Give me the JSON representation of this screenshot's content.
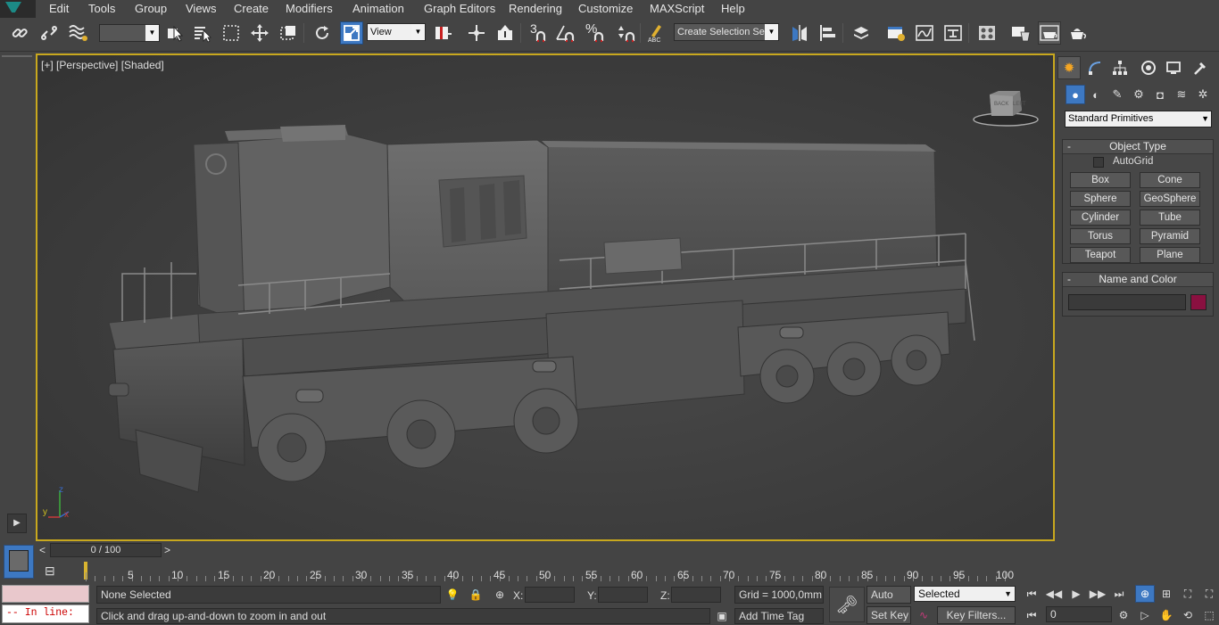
{
  "menubar": {
    "items": [
      "Edit",
      "Tools",
      "Group",
      "Views",
      "Create",
      "Modifiers",
      "Animation",
      "Graph Editors",
      "Rendering",
      "Customize",
      "MAXScript",
      "Help"
    ]
  },
  "toolbar": {
    "selection_filter_value": "",
    "reference_coord_value": "View",
    "named_selection_placeholder": "Create Selection Se",
    "snap_3_label": "3",
    "icons": [
      "link-icon",
      "unlink-icon",
      "bind-space-warp-icon",
      "select-object-icon",
      "select-by-name-icon",
      "rect-selection-icon",
      "window-crossing-icon",
      "move-icon",
      "rotate-icon",
      "scale-icon",
      "pivot-icon",
      "manipulate-icon",
      "keyboard-shortcut-icon",
      "snap-toggle-icon",
      "angle-snap-icon",
      "percent-snap-icon",
      "spinner-snap-icon",
      "edit-named-selection-icon",
      "mirror-icon",
      "align-icon",
      "layer-manager-icon",
      "graphite-icon",
      "curve-editor-icon",
      "schematic-view-icon",
      "material-editor-icon",
      "render-setup-icon",
      "rendered-frame-icon",
      "render-production-icon"
    ]
  },
  "viewport": {
    "label": "[+] [Perspective] [Shaded]",
    "axis_x": "x",
    "axis_y": "y",
    "axis_z": "z",
    "viewcube_left": "LEFT",
    "viewcube_front": "BACK"
  },
  "command_panel": {
    "tabs": [
      "create-icon",
      "modify-icon",
      "hierarchy-icon",
      "motion-icon",
      "display-icon",
      "utilities-icon"
    ],
    "subtabs": [
      "geometry-icon",
      "shapes-icon",
      "lights-icon",
      "cameras-icon",
      "helpers-icon",
      "spacewarps-icon",
      "systems-icon"
    ],
    "category": "Standard Primitives",
    "object_type": {
      "title": "Object Type",
      "autogrid_label": "AutoGrid",
      "autogrid_checked": false,
      "buttons": [
        "Box",
        "Cone",
        "Sphere",
        "GeoSphere",
        "Cylinder",
        "Tube",
        "Torus",
        "Pyramid",
        "Teapot",
        "Plane"
      ]
    },
    "name_and_color": {
      "title": "Name and Color",
      "name_value": "",
      "color": "#8a1040"
    },
    "rollout_toggle": "-"
  },
  "timeline": {
    "slider_text": "0 / 100",
    "prev": "<",
    "next": ">",
    "ticks": [
      "5",
      "10",
      "15",
      "20",
      "25",
      "30",
      "35",
      "40",
      "45",
      "50",
      "55",
      "60",
      "65",
      "70",
      "75",
      "80",
      "85",
      "90",
      "95",
      "100"
    ]
  },
  "statusbar": {
    "maxscript_line1": "",
    "maxscript_line2": "-- In line:",
    "selection_status": "None Selected",
    "prompt": "Click and drag up-and-down to zoom in and out",
    "x_label": "X:",
    "y_label": "Y:",
    "z_label": "Z:",
    "x_value": "",
    "y_value": "",
    "z_value": "",
    "grid": "Grid = 1000,0mm",
    "add_time_tag": "Add Time Tag",
    "auto_key": "Auto Key",
    "set_key": "Set Key",
    "key_mode_value": "Selected",
    "key_filters": "Key Filters...",
    "frame_value": "0"
  }
}
